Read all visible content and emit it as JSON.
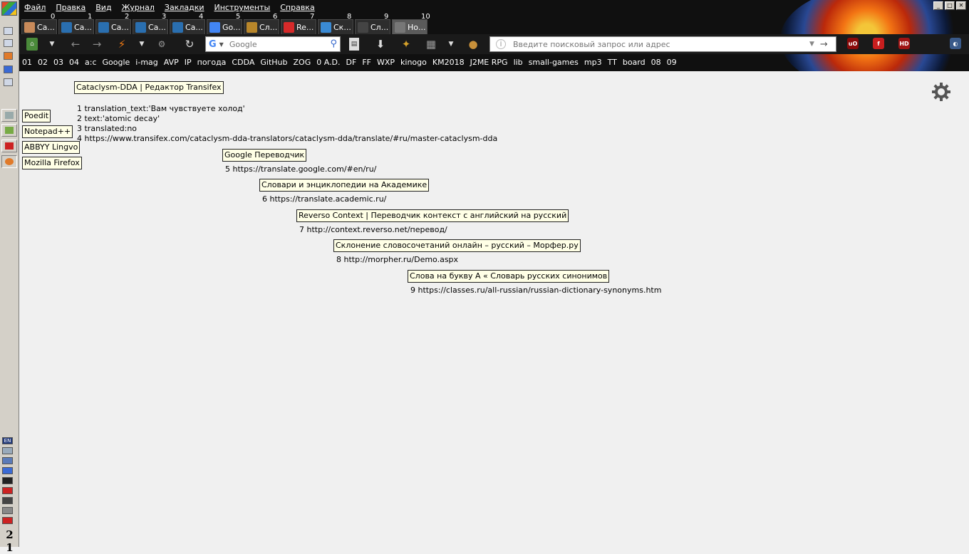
{
  "menu": [
    "Файл",
    "Правка",
    "Вид",
    "Журнал",
    "Закладки",
    "Инструменты",
    "Справка"
  ],
  "tabs": [
    {
      "num": "0",
      "label": "Ca...",
      "icon": "avatar-icon",
      "color": "#c88a5a"
    },
    {
      "num": "1",
      "label": "Ca...",
      "icon": "transifex-icon",
      "color": "#2a6fb0"
    },
    {
      "num": "2",
      "label": "Ca...",
      "icon": "transifex-icon",
      "color": "#2a6fb0"
    },
    {
      "num": "3",
      "label": "Ca...",
      "icon": "transifex-icon",
      "color": "#2a6fb0"
    },
    {
      "num": "4",
      "label": "Ca...",
      "icon": "transifex-icon",
      "color": "#2a6fb0"
    },
    {
      "num": "5",
      "label": "Go...",
      "icon": "google-translate-icon",
      "color": "#4285f4"
    },
    {
      "num": "6",
      "label": "Сл...",
      "icon": "books-icon",
      "color": "#b8862a"
    },
    {
      "num": "7",
      "label": "Re...",
      "icon": "reverso-icon",
      "color": "#d62a2a"
    },
    {
      "num": "8",
      "label": "Ск...",
      "icon": "morpher-icon",
      "color": "#3a8ad4"
    },
    {
      "num": "9",
      "label": "Сл...",
      "icon": "page-icon",
      "color": "#444"
    },
    {
      "num": "10",
      "label": "Но...",
      "icon": "firefox-icon",
      "color": "#777"
    }
  ],
  "search": {
    "engine": "G",
    "placeholder": "Google"
  },
  "urlbar": {
    "placeholder": "Введите поисковый запрос или адрес"
  },
  "addons": [
    {
      "name": "ublock-icon",
      "text": "uO",
      "color": "#8a0a0a"
    },
    {
      "name": "flash-icon",
      "text": "f",
      "color": "#c81e1e"
    },
    {
      "name": "hd-icon",
      "text": "HD",
      "color": "#a01414"
    },
    {
      "name": "mask-icon",
      "text": "◐",
      "color": "#3a5a8a"
    }
  ],
  "bookmarks": [
    "01",
    "02",
    "03",
    "04",
    "a:c",
    "Google",
    "i-mag",
    "AVP",
    "IP",
    "погода",
    "CDDA",
    "GitHub",
    "ZOG",
    "0 A.D.",
    "DF",
    "FF",
    "WXP",
    "kinogo",
    "KM2018",
    "J2ME RPG",
    "lib",
    "small-games",
    "mp3",
    "TT",
    "board",
    "08",
    "09"
  ],
  "page": {
    "apps": [
      "Poedit",
      "Notepad++",
      "ABBYY Lingvo",
      "Mozilla Firefox"
    ],
    "main_title": "Cataclysm-DDA | Редактор Transifex",
    "info_lines": [
      "1 translation_text:'Вам чувствуете холод'",
      "2 text:'atomic decay'",
      "3 translated:no",
      "4 https://www.transifex.com/cataclysm-dda-translators/cataclysm-dda/translate/#ru/master-cataclysm-dda"
    ],
    "links": [
      {
        "title": "Google Переводчик",
        "url": "5 https://translate.google.com/#en/ru/"
      },
      {
        "title": "Словари и энциклопедии на Академике",
        "url": "6 https://translate.academic.ru/"
      },
      {
        "title": "Reverso Context | Переводчик контекст с английский на русский",
        "url": "7 http://context.reverso.net/перевод/"
      },
      {
        "title": "Склонение словосочетаний онлайн – русский – Морфер.ру",
        "url": "8 http://morpher.ru/Demo.aspx"
      },
      {
        "title": "Слова на букву А « Словарь русских синонимов",
        "url": "9 https://classes.ru/all-russian/russian-dictionary-synonyms.htm"
      }
    ]
  },
  "tray": {
    "lang": "EN",
    "clock": "2 1"
  }
}
